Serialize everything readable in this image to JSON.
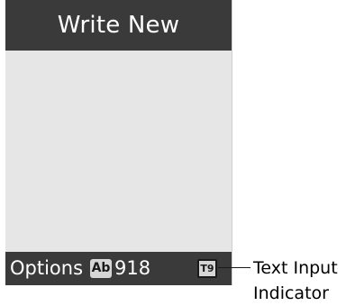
{
  "screen": {
    "title": "Write New"
  },
  "softkeys": {
    "left_label": "Options",
    "mode_badge": "Ab",
    "char_count": "918",
    "t9_badge": "T9"
  },
  "callout": {
    "line1": "Text Input",
    "line2": "Indicator"
  }
}
